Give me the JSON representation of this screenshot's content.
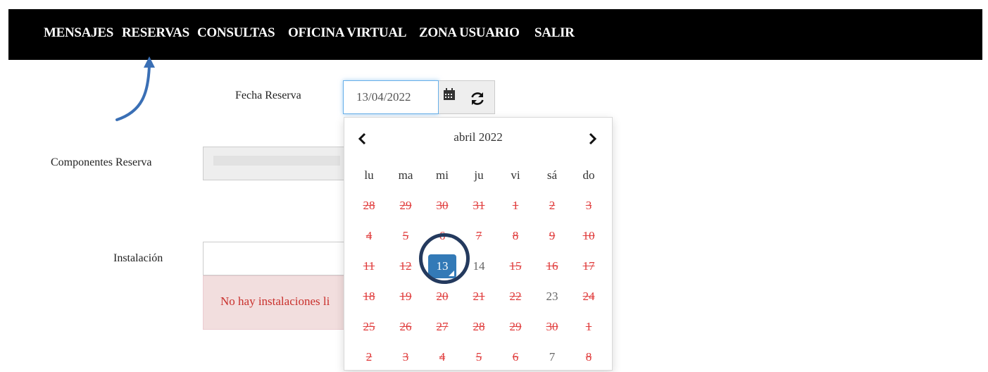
{
  "nav": {
    "items": [
      {
        "label": "MENSAJES"
      },
      {
        "label": "RESERVAS"
      },
      {
        "label": "CONSULTAS"
      },
      {
        "label": "OFICINA VIRTUAL"
      },
      {
        "label": "ZONA USUARIO"
      },
      {
        "label": "SALIR"
      }
    ]
  },
  "form": {
    "fecha_label": "Fecha Reserva",
    "fecha_value": "13/04/2022",
    "componentes_label": "Componentes Reserva",
    "instalacion_label": "Instalación",
    "alert_text": "No hay instalaciones li"
  },
  "datepicker": {
    "title": "abril 2022",
    "weekdays": [
      "lu",
      "ma",
      "mi",
      "ju",
      "vi",
      "sá",
      "do"
    ],
    "weeks": [
      [
        {
          "d": "28",
          "s": "disabled"
        },
        {
          "d": "29",
          "s": "disabled"
        },
        {
          "d": "30",
          "s": "disabled"
        },
        {
          "d": "31",
          "s": "disabled"
        },
        {
          "d": "1",
          "s": "disabled"
        },
        {
          "d": "2",
          "s": "disabled"
        },
        {
          "d": "3",
          "s": "disabled"
        }
      ],
      [
        {
          "d": "4",
          "s": "disabled"
        },
        {
          "d": "5",
          "s": "disabled"
        },
        {
          "d": "6",
          "s": "disabled"
        },
        {
          "d": "7",
          "s": "disabled"
        },
        {
          "d": "8",
          "s": "disabled"
        },
        {
          "d": "9",
          "s": "disabled"
        },
        {
          "d": "10",
          "s": "disabled"
        }
      ],
      [
        {
          "d": "11",
          "s": "disabled"
        },
        {
          "d": "12",
          "s": "disabled"
        },
        {
          "d": "13",
          "s": "active"
        },
        {
          "d": "14",
          "s": "enabled"
        },
        {
          "d": "15",
          "s": "disabled"
        },
        {
          "d": "16",
          "s": "disabled"
        },
        {
          "d": "17",
          "s": "disabled"
        }
      ],
      [
        {
          "d": "18",
          "s": "disabled"
        },
        {
          "d": "19",
          "s": "disabled"
        },
        {
          "d": "20",
          "s": "disabled"
        },
        {
          "d": "21",
          "s": "disabled"
        },
        {
          "d": "22",
          "s": "disabled"
        },
        {
          "d": "23",
          "s": "enabled"
        },
        {
          "d": "24",
          "s": "disabled"
        }
      ],
      [
        {
          "d": "25",
          "s": "disabled"
        },
        {
          "d": "26",
          "s": "disabled"
        },
        {
          "d": "27",
          "s": "disabled"
        },
        {
          "d": "28",
          "s": "disabled"
        },
        {
          "d": "29",
          "s": "disabled"
        },
        {
          "d": "30",
          "s": "disabled"
        },
        {
          "d": "1",
          "s": "disabled"
        }
      ],
      [
        {
          "d": "2",
          "s": "disabled"
        },
        {
          "d": "3",
          "s": "disabled"
        },
        {
          "d": "4",
          "s": "disabled"
        },
        {
          "d": "5",
          "s": "disabled"
        },
        {
          "d": "6",
          "s": "disabled"
        },
        {
          "d": "7",
          "s": "enabled"
        },
        {
          "d": "8",
          "s": "disabled"
        }
      ]
    ]
  },
  "icons": {
    "calendar": "calendar-icon",
    "refresh": "refresh-icon",
    "prev": "chevron-left-icon",
    "next": "chevron-right-icon"
  },
  "colors": {
    "navbar": "#000000",
    "active_day": "#337ab7",
    "disabled_day": "#e03b3b",
    "alert_bg": "#f2dede",
    "annotation": "#3a6fb5"
  }
}
